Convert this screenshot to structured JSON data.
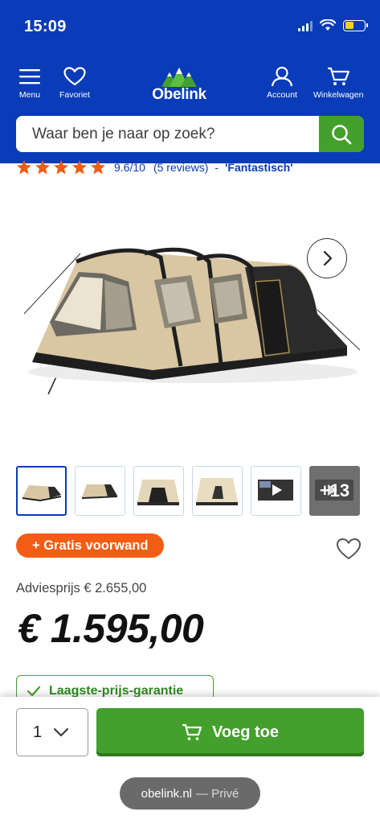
{
  "status_bar": {
    "time": "15:09"
  },
  "header": {
    "menu_label": "Menu",
    "favorites_label": "Favoriet",
    "logo_text": "Obelink",
    "account_label": "Account",
    "cart_label": "Winkelwagen",
    "brand_color": "#0a3bb8",
    "accent_color": "#44a02c"
  },
  "search": {
    "placeholder": "Waar ben je naar op zoek?"
  },
  "rating": {
    "stars": 5,
    "score": "9.6/10",
    "reviews": "(5 reviews)",
    "separator": "-",
    "word": "'Fantastisch'"
  },
  "gallery": {
    "thumbnail_count": 6,
    "active_index": 0,
    "more_label": "+13"
  },
  "product": {
    "promo": "+ Gratis voorwand",
    "list_price": "Adviesprijs € 2.655,00",
    "price": "€ 1.595,00",
    "guarantee": "Laagste-prijs-garantie"
  },
  "cart_bar": {
    "quantity": "1",
    "add_label": "Voeg toe"
  },
  "browser": {
    "domain": "obelink.nl",
    "mode": "— Privé"
  }
}
